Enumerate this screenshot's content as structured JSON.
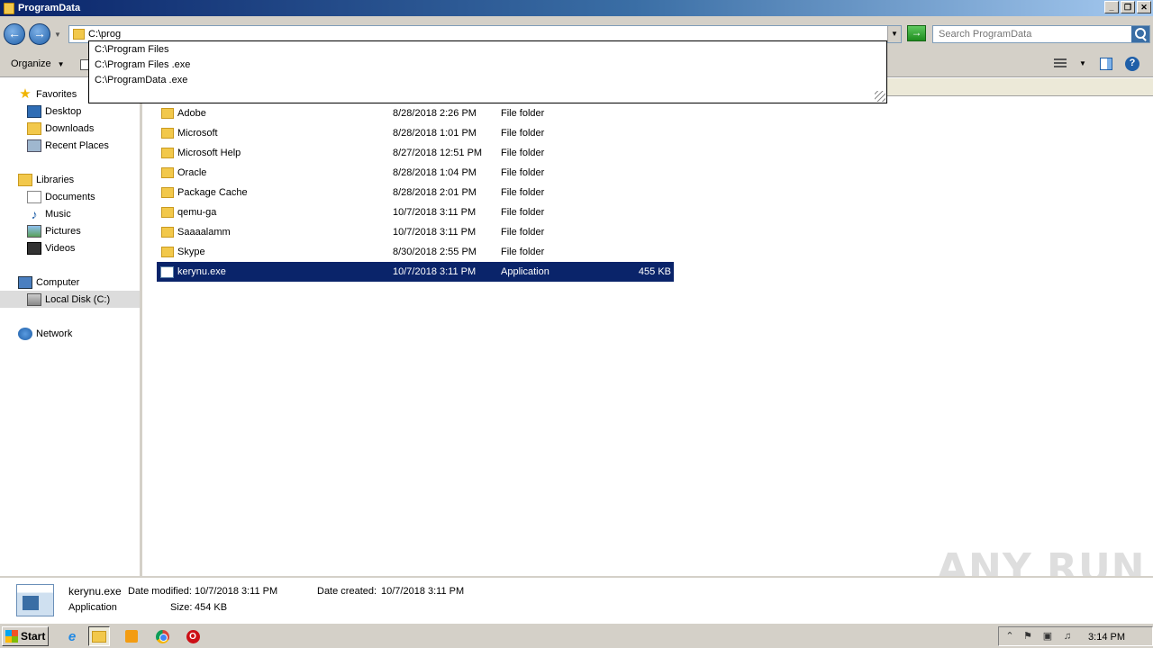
{
  "window": {
    "title": "ProgramData",
    "minimize": "_",
    "restore": "❐",
    "close": "✕"
  },
  "address": {
    "value": "C:\\prog",
    "go_icon": "→",
    "back_icon": "←",
    "forward_icon": "→",
    "dropdown_icon": "▼"
  },
  "search": {
    "placeholder": "Search ProgramData"
  },
  "autocomplete": {
    "items": [
      "C:\\Program Files",
      "C:\\Program Files .exe",
      "C:\\ProgramData .exe"
    ]
  },
  "toolbar": {
    "organize_label": "Organize",
    "organize_arrow": "▼",
    "view_arrow": "▼",
    "help_label": "?"
  },
  "nav": {
    "favorites": "Favorites",
    "desktop": "Desktop",
    "downloads": "Downloads",
    "recent_places": "Recent Places",
    "libraries": "Libraries",
    "documents": "Documents",
    "music": "Music",
    "pictures": "Pictures",
    "videos": "Videos",
    "computer": "Computer",
    "local_disk": "Local Disk (C:)",
    "network": "Network"
  },
  "files": [
    {
      "name": "Adobe",
      "date": "8/28/2018 2:26 PM",
      "type": "File folder",
      "size": ""
    },
    {
      "name": "Microsoft",
      "date": "8/28/2018 1:01 PM",
      "type": "File folder",
      "size": ""
    },
    {
      "name": "Microsoft Help",
      "date": "8/27/2018 12:51 PM",
      "type": "File folder",
      "size": ""
    },
    {
      "name": "Oracle",
      "date": "8/28/2018 1:04 PM",
      "type": "File folder",
      "size": ""
    },
    {
      "name": "Package Cache",
      "date": "8/28/2018 2:01 PM",
      "type": "File folder",
      "size": ""
    },
    {
      "name": "qemu-ga",
      "date": "10/7/2018 3:11 PM",
      "type": "File folder",
      "size": ""
    },
    {
      "name": "Saaaalamm",
      "date": "10/7/2018 3:11 PM",
      "type": "File folder",
      "size": ""
    },
    {
      "name": "Skype",
      "date": "8/30/2018 2:55 PM",
      "type": "File folder",
      "size": ""
    },
    {
      "name": "kerynu.exe",
      "date": "10/7/2018 3:11 PM",
      "type": "Application",
      "size": "455 KB"
    }
  ],
  "details": {
    "name": "kerynu.exe",
    "type": "Application",
    "modified_label": "Date modified:",
    "modified_value": "10/7/2018 3:11 PM",
    "created_label": "Date created:",
    "created_value": "10/7/2018 3:11 PM",
    "size_label": "Size:",
    "size_value": "454 KB"
  },
  "watermark": "ANY RUN",
  "taskbar": {
    "start_label": "Start",
    "ie_icon": "e",
    "opera_icon": "O",
    "tray_expand": "⌃",
    "clock": "3:14 PM"
  },
  "colors": {
    "selection": "#0a246a",
    "chrome": "#d4d0c8",
    "folder": "#f2c84b"
  }
}
